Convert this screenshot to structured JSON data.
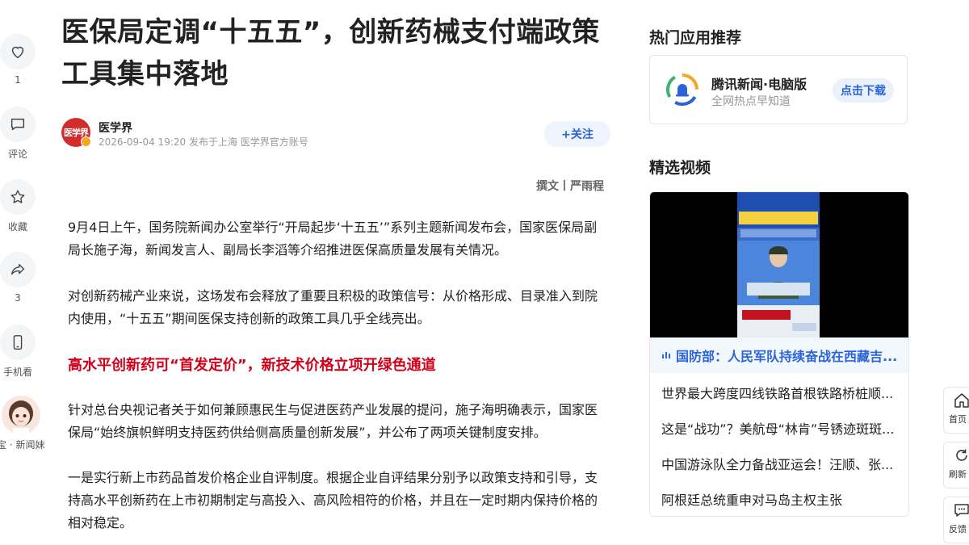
{
  "left_actions": {
    "like": {
      "count": "1"
    },
    "comment": {
      "label": "评论"
    },
    "favorite": {
      "label": "收藏"
    },
    "share": {
      "count": "3"
    },
    "mobile": {
      "label": "手机看"
    },
    "assistant": {
      "label": "宝 · 新闻妹"
    }
  },
  "article": {
    "title": "医保局定调“十五五”，创新药械支付端政策工具集中落地",
    "author": {
      "logo_text": "医学界",
      "name": "医学界",
      "meta": "2026-09-04 19:20  发布于上海  医学界官方账号"
    },
    "follow_label": "+关注",
    "byline": "撰文丨严雨程",
    "paragraphs": [
      "9月4日上午，国务院新闻办公室举行“开局起步‘十五五’”系列主题新闻发布会，国家医保局副局长施子海，新闻发言人、副局长李滔等介绍推进医保高质量发展有关情况。",
      "对创新药械产业来说，这场发布会释放了重要且积极的政策信号：从价格形成、目录准入到院内使用，“十五五”期间医保支持创新的政策工具几乎全线亮出。",
      "针对总台央视记者关于如何兼顾惠民生与促进医药产业发展的提问，施子海明确表示，国家医保局“始终旗帜鲜明支持医药供给侧高质量创新发展”，并公布了两项关键制度安排。",
      "一是实行新上市药品首发价格企业自评制度。根据企业自评结果分别予以政策支持和引导，支持高水平创新药在上市初期制定与高投入、高风险相符的价格，并且在一定时期内保持价格的相对稳定。"
    ],
    "subheading": "高水平创新药可“首发定价”，新技术价格立项开绿色通道"
  },
  "sidebar": {
    "apps_heading": "热门应用推荐",
    "app": {
      "name": "腾讯新闻·电脑版",
      "subtitle": "全网热点早知道",
      "download_label": "点击下载"
    },
    "videos_heading": "精选视频",
    "featured_video": {
      "caption": "国防部：人民军队持续奋战在西藏吉..."
    },
    "video_list": [
      "世界最大跨度四线铁路首根铁路桥桩顺...",
      "这是“战功”？美航母“林肯”号锈迹斑斑...",
      "中国游泳队全力备战亚运会！汪顺、张...",
      "阿根廷总统重申对马岛主权主张"
    ]
  },
  "float_buttons": {
    "home": "首页",
    "refresh": "刷新",
    "feedback": "反馈"
  },
  "colors": {
    "accent_blue": "#2a64d8",
    "subheading_red": "#d0021b",
    "logo_red": "#d22d2d"
  }
}
